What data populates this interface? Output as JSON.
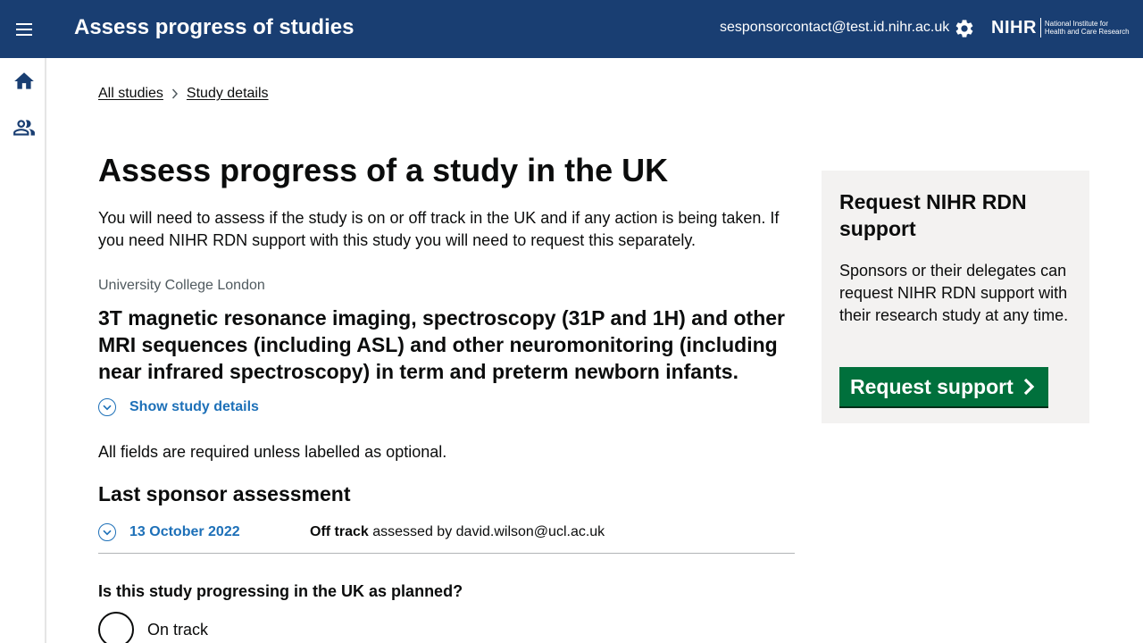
{
  "header": {
    "title": "Assess progress of studies",
    "user_email": "sesponsorcontact@test.id.nihr.ac.uk",
    "logo_main": "NIHR",
    "logo_sub_line1": "National Institute for",
    "logo_sub_line2": "Health and Care Research",
    "icons": [
      "menu-icon",
      "gear-icon"
    ]
  },
  "sidenav": {
    "items": [
      {
        "icon": "home-icon",
        "label": "Home"
      },
      {
        "icon": "people-icon",
        "label": "Users"
      }
    ]
  },
  "breadcrumb": {
    "items": [
      "All studies",
      "Study details"
    ]
  },
  "main": {
    "heading": "Assess progress of a study in the UK",
    "intro": "You will need to assess if the study is on or off track in the UK and if any action is being taken. If you need NIHR RDN support with this study you will need to request this separately.",
    "organisation": "University College London",
    "study_title": "3T magnetic resonance imaging, spectroscopy (31P and 1H) and other MRI sequences (including ASL) and other neuromonitoring (including near infrared spectroscopy) in term and preterm newborn infants.",
    "show_details_label": "Show study details",
    "fields_note": "All fields are required unless labelled as optional.",
    "last_assessment": {
      "heading": "Last sponsor assessment",
      "date": "13 October 2022",
      "status": "Off track",
      "assessed_by_prefix": "assessed by",
      "assessor": "david.wilson@ucl.ac.uk"
    },
    "question": "Is this study progressing in the UK as planned?",
    "options": [
      "On track"
    ]
  },
  "panel": {
    "title": "Request NIHR RDN support",
    "text": "Sponsors or their delegates can request NIHR RDN support with their research study at any time.",
    "button_label": "Request support"
  },
  "colors": {
    "header_bg": "#193e72",
    "link_blue": "#1d70b8",
    "button_green": "#00703c",
    "panel_bg": "#f3f2f1"
  }
}
